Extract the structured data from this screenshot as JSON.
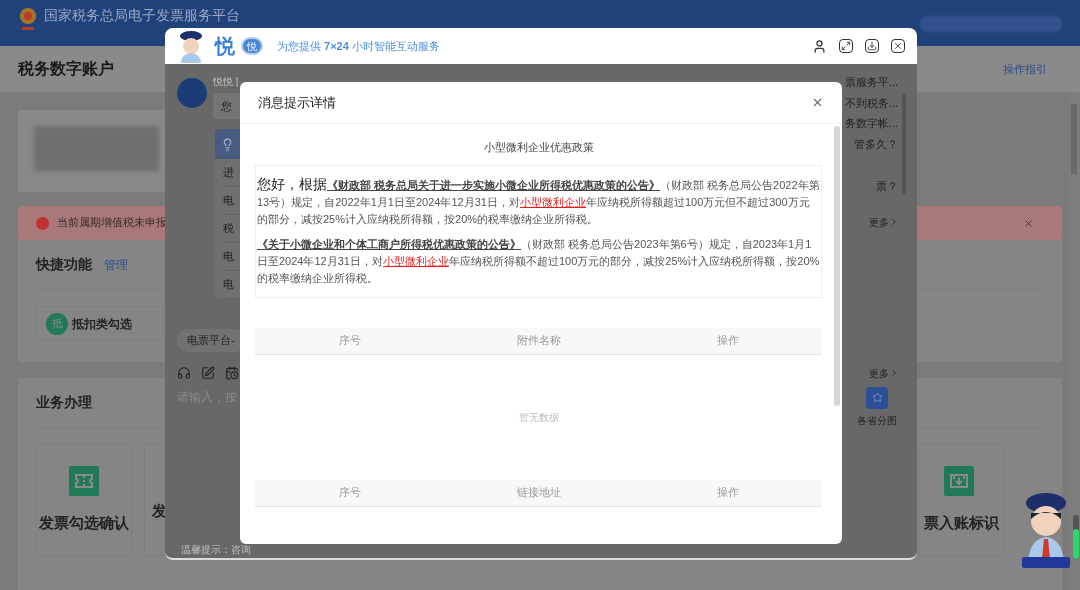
{
  "header": {
    "title": "国家税务总局电子发票服务平台"
  },
  "page": {
    "title": "税务数字账户",
    "guide_link": "操作指引"
  },
  "alert": {
    "text": "当前属期增值税未申报"
  },
  "quick": {
    "title": "快捷功能",
    "manage": "管理",
    "items": [
      {
        "badge": "抵",
        "label": "抵扣类勾选"
      }
    ]
  },
  "business": {
    "title": "业务办理",
    "tiles": [
      {
        "label": "发票勾选确认"
      },
      {
        "label": "发"
      }
    ],
    "right_tile": {
      "label": "票入账标识"
    }
  },
  "assistant": {
    "brand": "悦",
    "badge": "悦",
    "slogan": "为您提供 **7×24** 小时智能互动服务",
    "bot_name": "悦悦 |",
    "greeting": "您",
    "menu": [
      "进",
      "电",
      "税",
      "电",
      "电"
    ],
    "faq": [
      "票服务平...",
      "不到税务...",
      "务数字帐...",
      "管多久？",
      "票？"
    ],
    "more_links": [
      "更多",
      "更多"
    ],
    "app": {
      "label": "各省分图"
    },
    "channel": "电票平台-",
    "input_placeholder": "请输入，按",
    "tip": "温馨提示：咨询"
  },
  "dialog": {
    "title": "消息提示详情",
    "subject": "小型微利企业优惠政策",
    "paragraphs": [
      [
        {
          "kind": "lead",
          "text": "您好，根据"
        },
        {
          "kind": "title_link",
          "text": "《财政部 税务总局关于进一步实施小微企业所得税优惠政策的公告》"
        },
        {
          "kind": "text",
          "text": "（财政部 税务总局公告2022年第13号）规定，自2022年1月1日至2024年12月31日，对"
        },
        {
          "kind": "highlight_link",
          "text": "小型微利企业"
        },
        {
          "kind": "text",
          "text": "年应纳税所得额超过100万元但不超过300万元的部分，减按25%计入应纳税所得额，按20%的税率缴纳企业所得税。"
        }
      ],
      [
        {
          "kind": "title_link",
          "text": "《关于小微企业和个体工商户所得税优惠政策的公告》"
        },
        {
          "kind": "text",
          "text": "（财政部 税务总局公告2023年第6号）规定，自2023年1月1日至2024年12月31日，对"
        },
        {
          "kind": "highlight_link",
          "text": "小型微利企业"
        },
        {
          "kind": "text",
          "text": "年应纳税所得额不超过100万元的部分，减按25%计入应纳税所得额，按20%的税率缴纳企业所得税。"
        }
      ]
    ],
    "attachments": {
      "columns": [
        "序号",
        "附件名称",
        "操作"
      ],
      "empty": "暂无数据"
    },
    "links": {
      "columns": [
        "序号",
        "链接地址",
        "操作"
      ]
    }
  }
}
